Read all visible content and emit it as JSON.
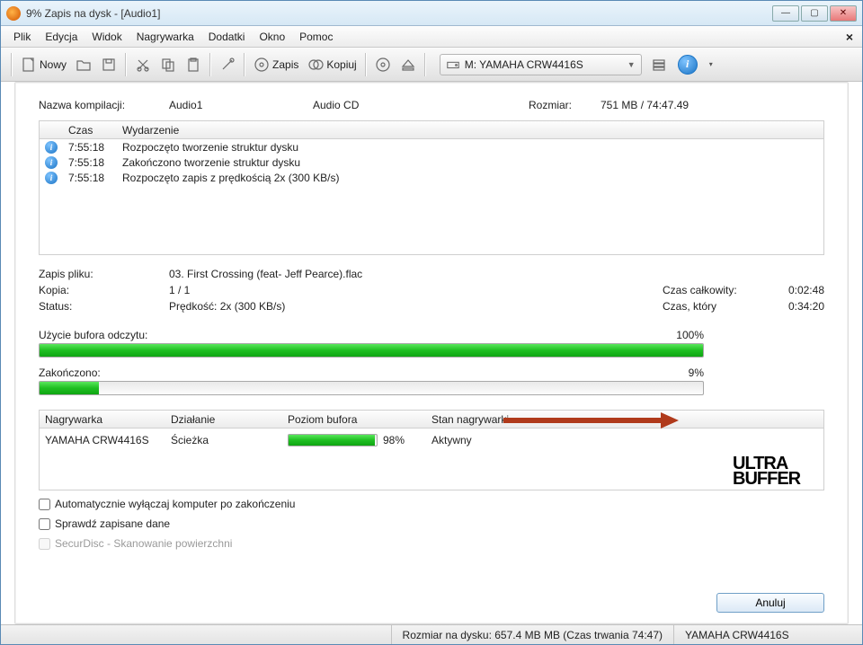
{
  "titlebar": {
    "title": "9% Zapis na dysk - [Audio1]"
  },
  "menubar": {
    "items": [
      "Plik",
      "Edycja",
      "Widok",
      "Nagrywarka",
      "Dodatki",
      "Okno",
      "Pomoc"
    ]
  },
  "toolbar": {
    "new_label": "Nowy",
    "write_label": "Zapis",
    "copy_label": "Kopiuj",
    "drive": "M: YAMAHA CRW4416S"
  },
  "compilation": {
    "label": "Nazwa kompilacji:",
    "name": "Audio1",
    "type": "Audio CD",
    "size_label": "Rozmiar:",
    "size": "751 MB    /    74:47.49"
  },
  "events": {
    "col_time": "Czas",
    "col_event": "Wydarzenie",
    "rows": [
      {
        "time": "7:55:18",
        "text": "Rozpoczęto tworzenie struktur dysku"
      },
      {
        "time": "7:55:18",
        "text": "Zakończono tworzenie struktur dysku"
      },
      {
        "time": "7:55:18",
        "text": "Rozpoczęto zapis z prędkością 2x (300 KB/s)"
      }
    ]
  },
  "details": {
    "file_label": "Zapis pliku:",
    "file": "03. First Crossing (feat- Jeff Pearce).flac",
    "copy_label": "Kopia:",
    "copy": "1 / 1",
    "total_time_label": "Czas całkowity:",
    "total_time": "0:02:48",
    "status_label": "Status:",
    "status": "Prędkość: 2x (300 KB/s)",
    "remaining_label": "Czas, który",
    "remaining": "0:34:20"
  },
  "progress": {
    "buffer_label": "Użycie bufora odczytu:",
    "buffer_pct": "100%",
    "buffer_fill": 100,
    "done_label": "Zakończono:",
    "done_pct": "9%",
    "done_fill": 9
  },
  "device": {
    "col_recorder": "Nagrywarka",
    "col_action": "Działanie",
    "col_buffer": "Poziom bufora",
    "col_state": "Stan nagrywarki",
    "recorder": "YAMAHA CRW4416S",
    "action": "Ścieżka",
    "buffer_pct": "98%",
    "buffer_fill": 98,
    "state": "Aktywny"
  },
  "checkboxes": {
    "shutdown": "Automatycznie wyłączaj komputer po zakończeniu",
    "verify": "Sprawdź zapisane dane",
    "securdisc": "SecurDisc - Skanowanie powierzchni"
  },
  "buttons": {
    "cancel": "Anuluj"
  },
  "statusbar": {
    "size": "Rozmiar na dysku: 657.4 MB MB (Czas trwania 74:47)",
    "device": "YAMAHA   CRW4416S"
  },
  "ultrabuffer": {
    "line1": "ULTRA",
    "line2": "BUFFER"
  }
}
